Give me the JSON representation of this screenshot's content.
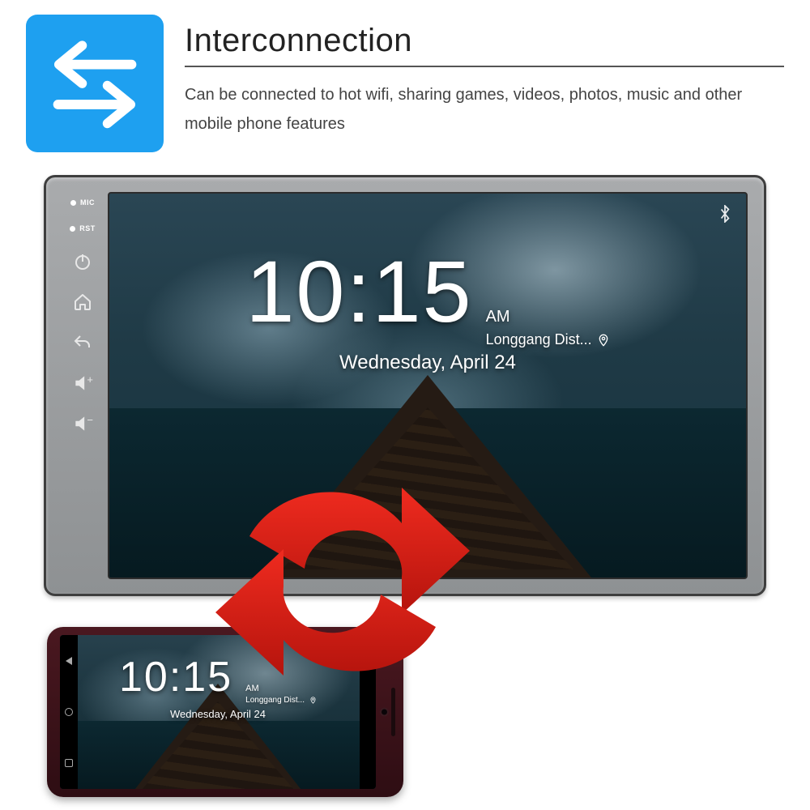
{
  "header": {
    "title": "Interconnection",
    "description": "Can be connected to hot wifi, sharing games, videos, photos, music and other mobile phone features"
  },
  "headunit": {
    "pins": {
      "mic": "MIC",
      "rst": "RST"
    },
    "clock": {
      "time": "10:15",
      "ampm": "AM",
      "location": "Longgang Dist...",
      "date": "Wednesday, April 24"
    }
  },
  "phone": {
    "clock": {
      "time": "10:15",
      "ampm": "AM",
      "location": "Longgang Dist...",
      "date": "Wednesday, April 24"
    }
  }
}
